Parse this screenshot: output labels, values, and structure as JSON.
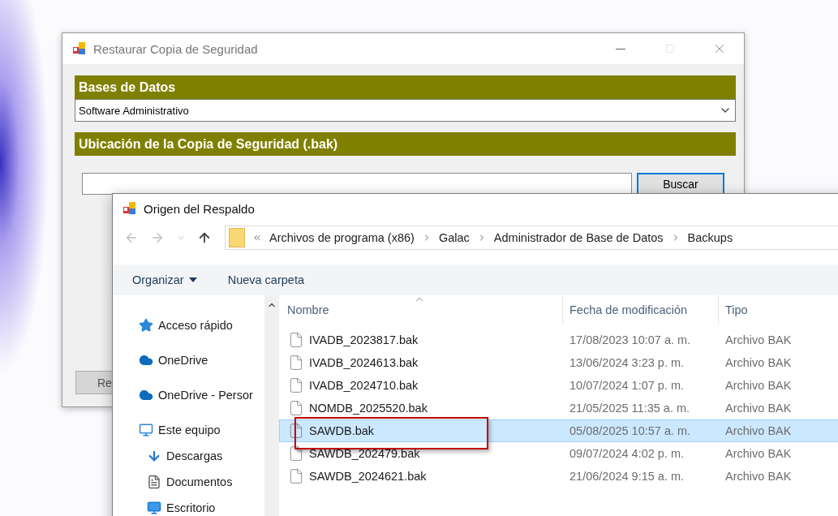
{
  "back_window": {
    "title": "Restaurar Copia de Seguridad",
    "database_header": "Bases de Datos",
    "database_select": {
      "value": "Software Administrativo"
    },
    "location_header": "Ubicación de la Copia de Seguridad (.bak)",
    "search_button": "Buscar",
    "bottom_button": "Re"
  },
  "dialog": {
    "title": "Origen del Respaldo",
    "breadcrumb": [
      "Archivos de programa (x86)",
      "Galac",
      "Administrador de Base de Datos",
      "Backups"
    ],
    "organize_button": "Organizar",
    "new_folder_button": "Nueva carpeta",
    "nav_items": [
      {
        "label": "Acceso rápido",
        "kind": "star"
      },
      {
        "label": "OneDrive",
        "kind": "cloud"
      },
      {
        "label": "OneDrive - Persor",
        "kind": "cloud"
      },
      {
        "label": "Este equipo",
        "kind": "computer",
        "children": [
          {
            "label": "Descargas",
            "kind": "download"
          },
          {
            "label": "Documentos",
            "kind": "document"
          },
          {
            "label": "Escritorio",
            "kind": "desktop"
          }
        ]
      }
    ],
    "columns": [
      "Nombre",
      "Fecha de modificación",
      "Tipo"
    ],
    "rows": [
      {
        "name": "IVADB_2023817.bak",
        "date": "17/08/2023 10:07 a. m.",
        "type": "Archivo BAK",
        "selected": false
      },
      {
        "name": "IVADB_2024613.bak",
        "date": "13/06/2024 3:23 p. m.",
        "type": "Archivo BAK",
        "selected": false
      },
      {
        "name": "IVADB_2024710.bak",
        "date": "10/07/2024 1:07 p. m.",
        "type": "Archivo BAK",
        "selected": false
      },
      {
        "name": "NOMDB_2025520.bak",
        "date": "21/05/2025 11:35 a. m.",
        "type": "Archivo BAK",
        "selected": false
      },
      {
        "name": "SAWDB.bak",
        "date": "05/08/2025 10:57 a. m.",
        "type": "Archivo BAK",
        "selected": true
      },
      {
        "name": "SAWDB_202479.bak",
        "date": "09/07/2024 4:02 p. m.",
        "type": "Archivo BAK",
        "selected": false
      },
      {
        "name": "SAWDB_2024621.bak",
        "date": "21/06/2024 9:15 a. m.",
        "type": "Archivo BAK",
        "selected": false
      }
    ]
  }
}
